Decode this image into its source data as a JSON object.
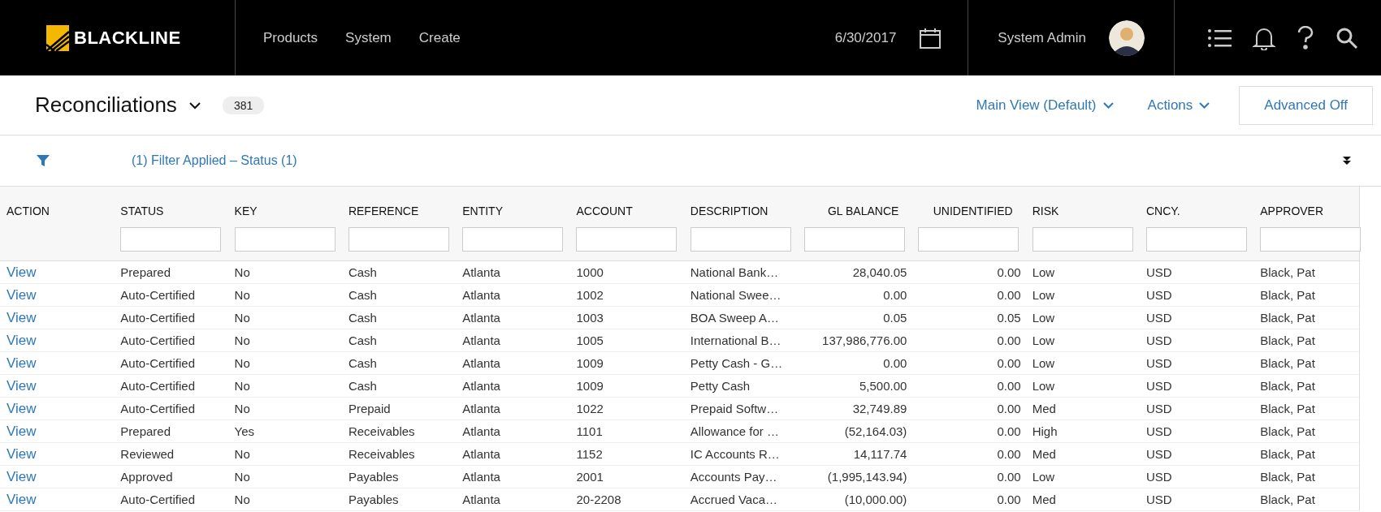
{
  "navbar": {
    "logo": "BLACKLINE",
    "menu": [
      "Products",
      "System",
      "Create"
    ],
    "date": "6/30/2017",
    "user": "System Admin"
  },
  "header": {
    "title": "Reconciliations",
    "count": "381",
    "view_menu": "Main View (Default)",
    "actions_menu": "Actions",
    "advanced_button": "Advanced Off"
  },
  "filter_bar": {
    "summary": "(1) Filter Applied – Status (1)"
  },
  "table": {
    "columns": [
      {
        "label": "ACTION",
        "kind": "text"
      },
      {
        "label": "STATUS",
        "kind": "text"
      },
      {
        "label": "KEY",
        "kind": "text"
      },
      {
        "label": "REFERENCE",
        "kind": "text"
      },
      {
        "label": "ENTITY",
        "kind": "text"
      },
      {
        "label": "ACCOUNT",
        "kind": "text"
      },
      {
        "label": "DESCRIPTION",
        "kind": "text"
      },
      {
        "label": "GL BALANCE",
        "kind": "amount"
      },
      {
        "label": "UNIDENTIFIED",
        "kind": "amount"
      },
      {
        "label": "RISK",
        "kind": "text"
      },
      {
        "label": "CNCY.",
        "kind": "text"
      },
      {
        "label": "APPROVER",
        "kind": "text"
      }
    ],
    "rows": [
      [
        "View",
        "Prepared",
        "No",
        "Cash",
        "Atlanta",
        "1000",
        "National Bank…",
        "28,040.05",
        "0.00",
        "Low",
        "USD",
        "Black, Pat"
      ],
      [
        "View",
        "Auto-Certified",
        "No",
        "Cash",
        "Atlanta",
        "1002",
        "National Swee…",
        "0.00",
        "0.00",
        "Low",
        "USD",
        "Black, Pat"
      ],
      [
        "View",
        "Auto-Certified",
        "No",
        "Cash",
        "Atlanta",
        "1003",
        "BOA Sweep A…",
        "0.05",
        "0.05",
        "Low",
        "USD",
        "Black, Pat"
      ],
      [
        "View",
        "Auto-Certified",
        "No",
        "Cash",
        "Atlanta",
        "1005",
        "International B…",
        "137,986,776.00",
        "0.00",
        "Low",
        "USD",
        "Black, Pat"
      ],
      [
        "View",
        "Auto-Certified",
        "No",
        "Cash",
        "Atlanta",
        "1009",
        "Petty Cash - G…",
        "0.00",
        "0.00",
        "Low",
        "USD",
        "Black, Pat"
      ],
      [
        "View",
        "Auto-Certified",
        "No",
        "Cash",
        "Atlanta",
        "1009",
        "Petty Cash",
        "5,500.00",
        "0.00",
        "Low",
        "USD",
        "Black, Pat"
      ],
      [
        "View",
        "Auto-Certified",
        "No",
        "Prepaid",
        "Atlanta",
        "1022",
        "Prepaid Softw…",
        "32,749.89",
        "0.00",
        "Med",
        "USD",
        "Black, Pat"
      ],
      [
        "View",
        "Prepared",
        "Yes",
        "Receivables",
        "Atlanta",
        "1101",
        "Allowance for …",
        "(52,164.03)",
        "0.00",
        "High",
        "USD",
        "Black, Pat"
      ],
      [
        "View",
        "Reviewed",
        "No",
        "Receivables",
        "Atlanta",
        "1152",
        "IC Accounts R…",
        "14,117.74",
        "0.00",
        "Med",
        "USD",
        "Black, Pat"
      ],
      [
        "View",
        "Approved",
        "No",
        "Payables",
        "Atlanta",
        "2001",
        "Accounts Pay…",
        "(1,995,143.94)",
        "0.00",
        "Low",
        "USD",
        "Black, Pat"
      ],
      [
        "View",
        "Auto-Certified",
        "No",
        "Payables",
        "Atlanta",
        "20-2208",
        "Accrued Vaca…",
        "(10,000.00)",
        "0.00",
        "Med",
        "USD",
        "Black, Pat"
      ]
    ]
  }
}
